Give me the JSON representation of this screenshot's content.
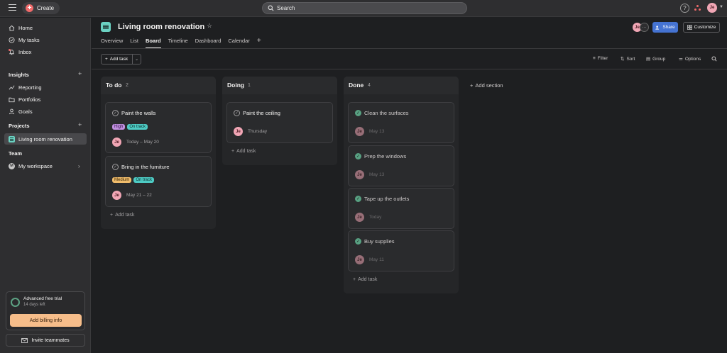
{
  "topbar": {
    "create_label": "Create",
    "search_placeholder": "Search",
    "help_label": "?",
    "user_initials": "Je"
  },
  "sidebar": {
    "nav": [
      {
        "label": "Home",
        "icon": "home-icon"
      },
      {
        "label": "My tasks",
        "icon": "check-circle-icon"
      },
      {
        "label": "Inbox",
        "icon": "bell-icon"
      }
    ],
    "insights_label": "Insights",
    "insights": [
      {
        "label": "Reporting",
        "icon": "trend-icon"
      },
      {
        "label": "Portfolios",
        "icon": "folder-icon"
      },
      {
        "label": "Goals",
        "icon": "person-icon"
      }
    ],
    "projects_label": "Projects",
    "project_item": "Living room renovation",
    "team_label": "Team",
    "workspace_label": "My workspace",
    "workspace_initial": "M",
    "trial_title": "Advanced free trial",
    "trial_sub": "14 days left",
    "billing_label": "Add billing info",
    "invite_label": "Invite teammates"
  },
  "project": {
    "title": "Living room renovation",
    "tabs": [
      "Overview",
      "List",
      "Board",
      "Timeline",
      "Dashboard",
      "Calendar"
    ],
    "active_tab": "Board",
    "member_initials": "Je",
    "more_label": "···",
    "share_label": "Share",
    "customize_label": "Customize"
  },
  "toolbar": {
    "add_task_label": "Add task",
    "filter_label": "Filter",
    "sort_label": "Sort",
    "group_label": "Group",
    "options_label": "Options"
  },
  "board": {
    "columns": [
      {
        "name": "To do",
        "count": "2",
        "add_label": "Add task",
        "cards": [
          {
            "title": "Paint the walls",
            "tags": [
              "High",
              "On track"
            ],
            "assignee": "Je",
            "date": "Today – May 20"
          },
          {
            "title": "Bring in the furniture",
            "tags": [
              "Medium",
              "On track"
            ],
            "assignee": "Je",
            "date": "May 21 – 22"
          }
        ]
      },
      {
        "name": "Doing",
        "count": "1",
        "add_label": "Add task",
        "cards": [
          {
            "title": "Paint the ceiling",
            "assignee": "Je",
            "date": "Thursday"
          }
        ]
      },
      {
        "name": "Done",
        "count": "4",
        "add_label": "Add task",
        "cards": [
          {
            "title": "Clean the surfaces",
            "assignee": "Je",
            "date": "May 13"
          },
          {
            "title": "Prep the windows",
            "assignee": "Je",
            "date": "May 13"
          },
          {
            "title": "Tape up the outlets",
            "assignee": "Je",
            "date": "Today"
          },
          {
            "title": "Buy supplies",
            "assignee": "Je",
            "date": "May 11"
          }
        ]
      }
    ],
    "add_section_label": "Add section"
  },
  "colors": {
    "accent_coral": "#f06a6a",
    "share_blue": "#4573d2",
    "billing_orange": "#f6bd8a",
    "project_teal": "#6bd2c2",
    "done_green": "#58a182"
  }
}
